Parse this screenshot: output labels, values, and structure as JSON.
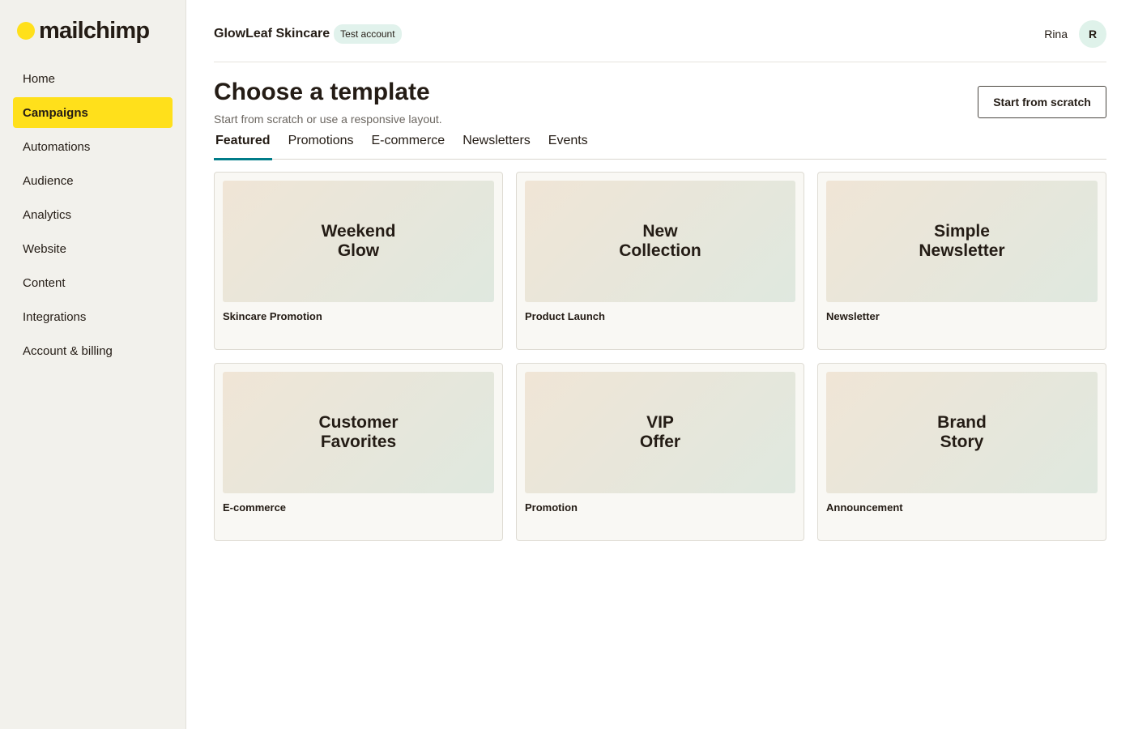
{
  "brand": {
    "name": "mailchimp",
    "accent": "#ffe01b",
    "tab_accent": "#007c89"
  },
  "sidebar": {
    "items": [
      {
        "label": "Home",
        "active": false
      },
      {
        "label": "Campaigns",
        "active": true
      },
      {
        "label": "Automations",
        "active": false
      },
      {
        "label": "Audience",
        "active": false
      },
      {
        "label": "Analytics",
        "active": false
      },
      {
        "label": "Website",
        "active": false
      },
      {
        "label": "Content",
        "active": false
      },
      {
        "label": "Integrations",
        "active": false
      },
      {
        "label": "Account & billing",
        "active": false
      }
    ]
  },
  "header": {
    "account_name": "GlowLeaf Skincare",
    "account_badge": "Test account",
    "user_name": "Rina",
    "avatar_initial": "R"
  },
  "page": {
    "title": "Choose a template",
    "subtitle": "Start from scratch or use a responsive layout.",
    "start_button": "Start from scratch"
  },
  "tabs": [
    {
      "label": "Featured",
      "active": true
    },
    {
      "label": "Promotions",
      "active": false
    },
    {
      "label": "E-commerce",
      "active": false
    },
    {
      "label": "Newsletters",
      "active": false
    },
    {
      "label": "Events",
      "active": false
    }
  ],
  "templates": [
    {
      "preview": "Weekend\nGlow",
      "label": "Skincare Promotion"
    },
    {
      "preview": "New\nCollection",
      "label": "Product Launch"
    },
    {
      "preview": "Simple\nNewsletter",
      "label": "Newsletter"
    },
    {
      "preview": "Customer\nFavorites",
      "label": "E-commerce"
    },
    {
      "preview": "VIP\nOffer",
      "label": "Promotion"
    },
    {
      "preview": "Brand\nStory",
      "label": "Announcement"
    }
  ]
}
